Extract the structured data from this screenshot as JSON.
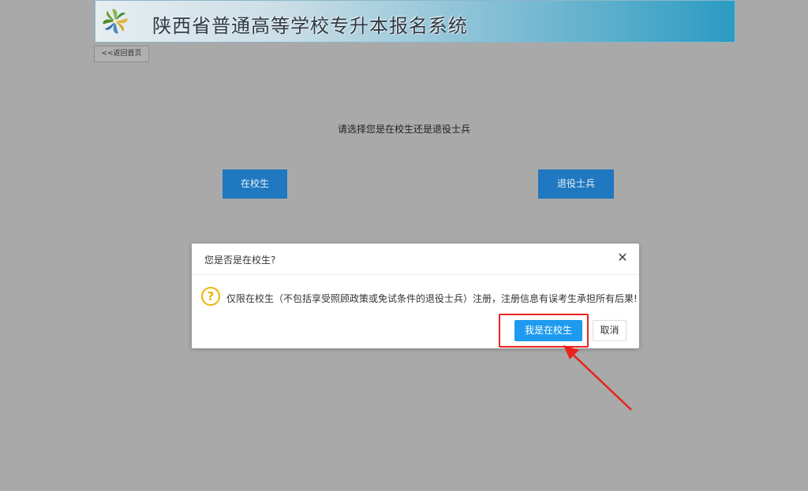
{
  "banner": {
    "title": "陕西省普通高等学校专升本报名系统",
    "logo_icon": "pinwheel-logo-icon"
  },
  "nav": {
    "back_label": "<<返回首页"
  },
  "main": {
    "prompt": "请选择您是在校生还是退役士兵",
    "student_label": "在校生",
    "veteran_label": "退役士兵",
    "button_color": "#1f78c0"
  },
  "dialog": {
    "title": "您是否是在校生?",
    "close_icon": "close-icon",
    "warning_icon": "question-circle-icon",
    "message": "仅限在校生（不包括享受照顾政策或免试条件的退役士兵）注册，注册信息有误考生承担所有后果!",
    "confirm_label": "我是在校生",
    "cancel_label": "取消",
    "confirm_color": "#1e9bf0"
  },
  "annotation": {
    "highlight_color": "#e8231c"
  }
}
